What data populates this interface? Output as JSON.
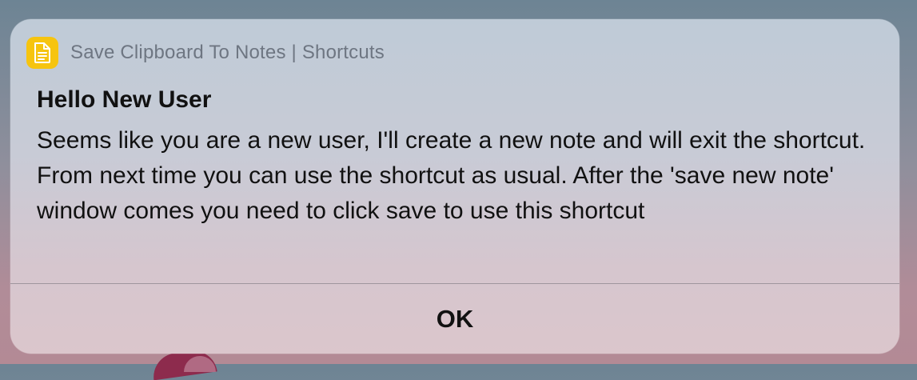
{
  "notification": {
    "app_icon": "notes-document-icon",
    "app_title": "Save Clipboard To Notes | Shortcuts",
    "title": "Hello New User",
    "message": "Seems like you are a new user, I'll create a new note and will exit the shortcut. From next time you can use the shortcut as usual. After the 'save new note' window comes you need to click save to use this shortcut",
    "ok_label": "OK"
  },
  "colors": {
    "app_icon_bg": "#f6c40f",
    "dialog_bg_top": "#bfcbd7",
    "dialog_bg_bottom": "#dbc6cc"
  }
}
